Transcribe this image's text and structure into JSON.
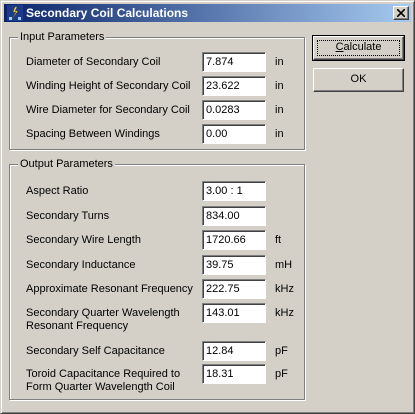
{
  "window": {
    "title": "Secondary Coil Calculations",
    "icon": "tesla-coil-app-icon"
  },
  "input": {
    "legend": "Input Parameters",
    "rows": [
      {
        "label": "Diameter of Secondary Coil",
        "value": "7.874",
        "unit": "in"
      },
      {
        "label": "Winding Height of Secondary Coil",
        "value": "23.622",
        "unit": "in"
      },
      {
        "label": "Wire Diameter for Secondary Coil",
        "value": "0.0283",
        "unit": "in"
      },
      {
        "label": "Spacing Between Windings",
        "value": "0.00",
        "unit": "in"
      }
    ]
  },
  "output": {
    "legend": "Output Parameters",
    "rows": [
      {
        "label": "Aspect Ratio",
        "value": "3.00 : 1",
        "unit": ""
      },
      {
        "label": "Secondary Turns",
        "value": "834.00",
        "unit": ""
      },
      {
        "label": "Secondary Wire Length",
        "value": "1720.66",
        "unit": "ft"
      },
      {
        "label": "Secondary Inductance",
        "value": "39.75",
        "unit": "mH"
      },
      {
        "label": "Approximate Resonant Frequency",
        "value": "222.75",
        "unit": "kHz"
      },
      {
        "label_line1": "Secondary Quarter Wavelength",
        "label_line2": "Resonant Frequency",
        "value": "143.01",
        "unit": "kHz"
      },
      {
        "label": "Secondary Self Capacitance",
        "value": "12.84",
        "unit": "pF"
      },
      {
        "label_line1": "Toroid Capacitance Required to",
        "label_line2": "Form Quarter Wavelength Coil",
        "value": "18.31",
        "unit": "pF"
      }
    ]
  },
  "buttons": {
    "calculate_first": "C",
    "calculate_rest": "alculate",
    "ok": "OK"
  }
}
